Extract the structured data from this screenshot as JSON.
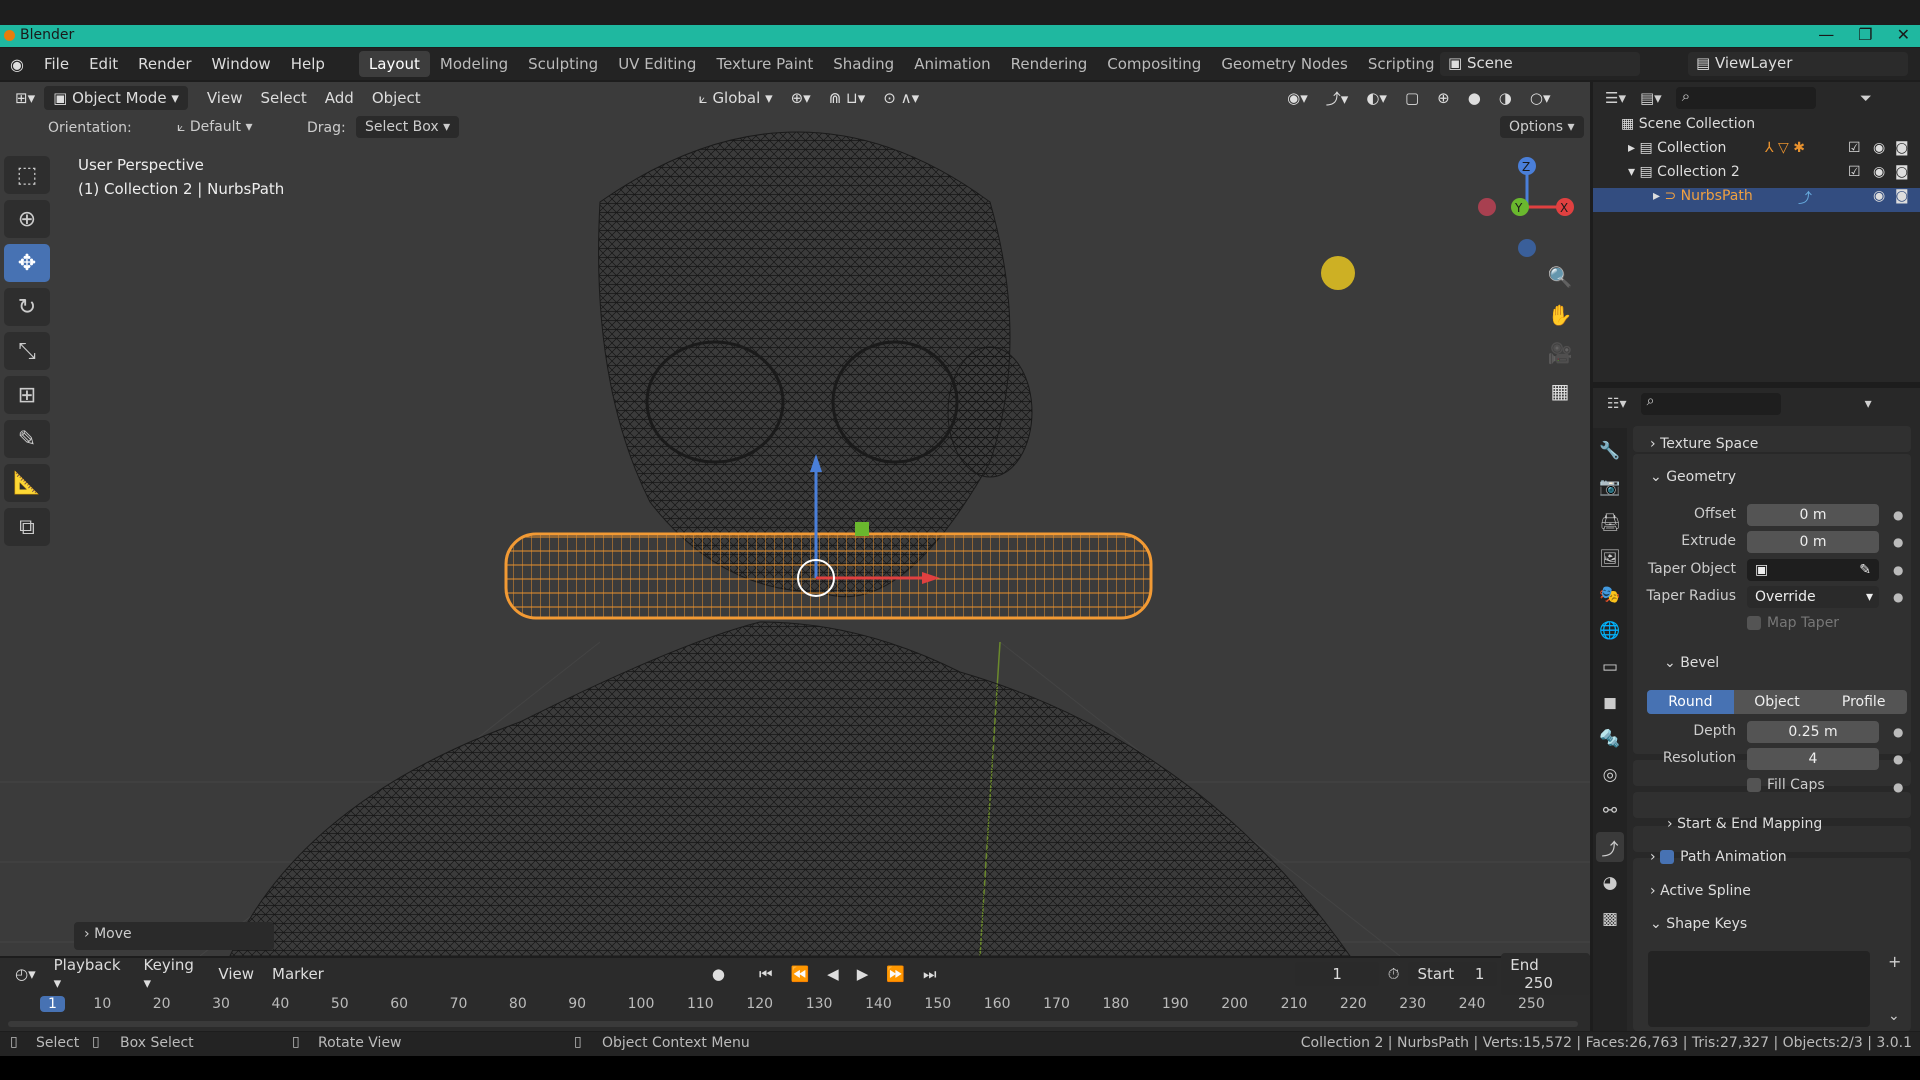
{
  "window": {
    "title": "Blender"
  },
  "menu": [
    "File",
    "Edit",
    "Render",
    "Window",
    "Help"
  ],
  "workspaces": [
    "Layout",
    "Modeling",
    "Sculpting",
    "UV Editing",
    "Texture Paint",
    "Shading",
    "Animation",
    "Rendering",
    "Compositing",
    "Geometry Nodes",
    "Scripting"
  ],
  "active_workspace": "Layout",
  "scene": "Scene",
  "view_layer": "ViewLayer",
  "viewport": {
    "mode": "Object Mode",
    "header_menus": [
      "View",
      "Select",
      "Add",
      "Object"
    ],
    "transform_orientation": "Global",
    "options": "Options",
    "orientation_label": "Orientation:",
    "orientation_value": "Default",
    "drag_label": "Drag:",
    "drag_value": "Select Box",
    "perspective": "User Perspective",
    "active_info": "(1) Collection 2 | NurbsPath",
    "last_op": "Move",
    "gizmo_axes": [
      "Z",
      "X",
      "Y"
    ]
  },
  "outliner": {
    "root": "Scene Collection",
    "items": [
      {
        "label": "Collection"
      },
      {
        "label": "Collection 2"
      },
      {
        "label": "NurbsPath"
      }
    ]
  },
  "properties": {
    "texture_space": "Texture Space",
    "geometry": "Geometry",
    "offset_label": "Offset",
    "offset": "0 m",
    "extrude_label": "Extrude",
    "extrude": "0 m",
    "taper_object_label": "Taper Object",
    "taper_radius_label": "Taper Radius",
    "taper_radius": "Override",
    "map_taper": "Map Taper",
    "bevel": "Bevel",
    "bevel_modes": [
      "Round",
      "Object",
      "Profile"
    ],
    "depth_label": "Depth",
    "depth": "0.25 m",
    "resolution_label": "Resolution",
    "resolution": "4",
    "fill_caps": "Fill Caps",
    "start_end": "Start & End Mapping",
    "path_animation": "Path Animation",
    "active_spline": "Active Spline",
    "shape_keys": "Shape Keys"
  },
  "timeline": {
    "menus": [
      "Playback",
      "Keying",
      "View",
      "Marker"
    ],
    "current_frame": "1",
    "start_label": "Start",
    "start": "1",
    "end_label": "End",
    "end": "250",
    "ticks": [
      "1",
      "10",
      "20",
      "30",
      "40",
      "50",
      "60",
      "70",
      "80",
      "90",
      "100",
      "110",
      "120",
      "130",
      "140",
      "150",
      "160",
      "170",
      "180",
      "190",
      "200",
      "210",
      "220",
      "230",
      "240",
      "250"
    ]
  },
  "status": {
    "select": "Select",
    "box_select": "Box Select",
    "rotate_view": "Rotate View",
    "context_menu": "Object Context Menu",
    "stats": "Collection 2 | NurbsPath | Verts:15,572 | Faces:26,763 | Tris:27,327 | Objects:2/3 | 3.0.1"
  }
}
